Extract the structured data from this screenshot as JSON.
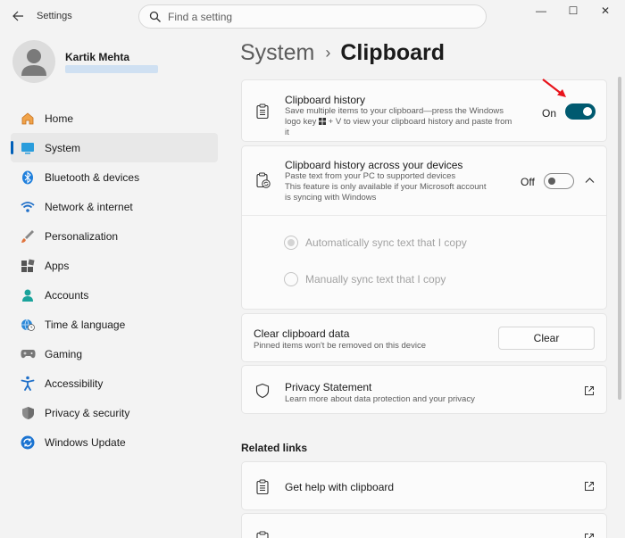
{
  "window": {
    "app_title": "Settings",
    "search_placeholder": "Find a setting",
    "minimize": "—",
    "maximize": "☐",
    "close": "✕"
  },
  "profile": {
    "name": "Kartik Mehta"
  },
  "sidebar": {
    "items": [
      {
        "label": "Home",
        "icon": "home-icon"
      },
      {
        "label": "System",
        "icon": "system-icon",
        "active": true
      },
      {
        "label": "Bluetooth & devices",
        "icon": "bluetooth-icon"
      },
      {
        "label": "Network & internet",
        "icon": "wifi-icon"
      },
      {
        "label": "Personalization",
        "icon": "brush-icon"
      },
      {
        "label": "Apps",
        "icon": "apps-icon"
      },
      {
        "label": "Accounts",
        "icon": "accounts-icon"
      },
      {
        "label": "Time & language",
        "icon": "globe-clock-icon"
      },
      {
        "label": "Gaming",
        "icon": "gamepad-icon"
      },
      {
        "label": "Accessibility",
        "icon": "accessibility-icon"
      },
      {
        "label": "Privacy & security",
        "icon": "shield-icon"
      },
      {
        "label": "Windows Update",
        "icon": "update-icon"
      }
    ]
  },
  "breadcrumb": {
    "parent": "System",
    "separator": "›",
    "current": "Clipboard"
  },
  "clipboard_history": {
    "title": "Clipboard history",
    "desc_line1": "Save multiple items to your clipboard—press the Windows",
    "desc_line2_pre": "logo key ",
    "desc_line2_post": " + V to view your clipboard history and paste from",
    "desc_line3": "it",
    "state_label": "On",
    "state": true
  },
  "sync_devices": {
    "title": "Clipboard history across your devices",
    "desc_line1": "Paste text from your PC to supported devices",
    "desc_line2": "This feature is only available if your Microsoft account",
    "desc_line3": "is syncing with Windows",
    "state_label": "Off",
    "state": false,
    "options": [
      "Automatically sync text that I copy",
      "Manually sync text that I copy"
    ]
  },
  "clear_data": {
    "title": "Clear clipboard data",
    "desc": "Pinned items won't be removed on this device",
    "button": "Clear"
  },
  "privacy": {
    "title": "Privacy Statement",
    "desc": "Learn more about data protection and your privacy"
  },
  "related": {
    "heading": "Related links",
    "links": [
      {
        "label": "Get help with clipboard"
      }
    ]
  },
  "colors": {
    "accent": "#005a70",
    "sidebar_accent": "#005fb8",
    "arrow": "#e8141c"
  }
}
